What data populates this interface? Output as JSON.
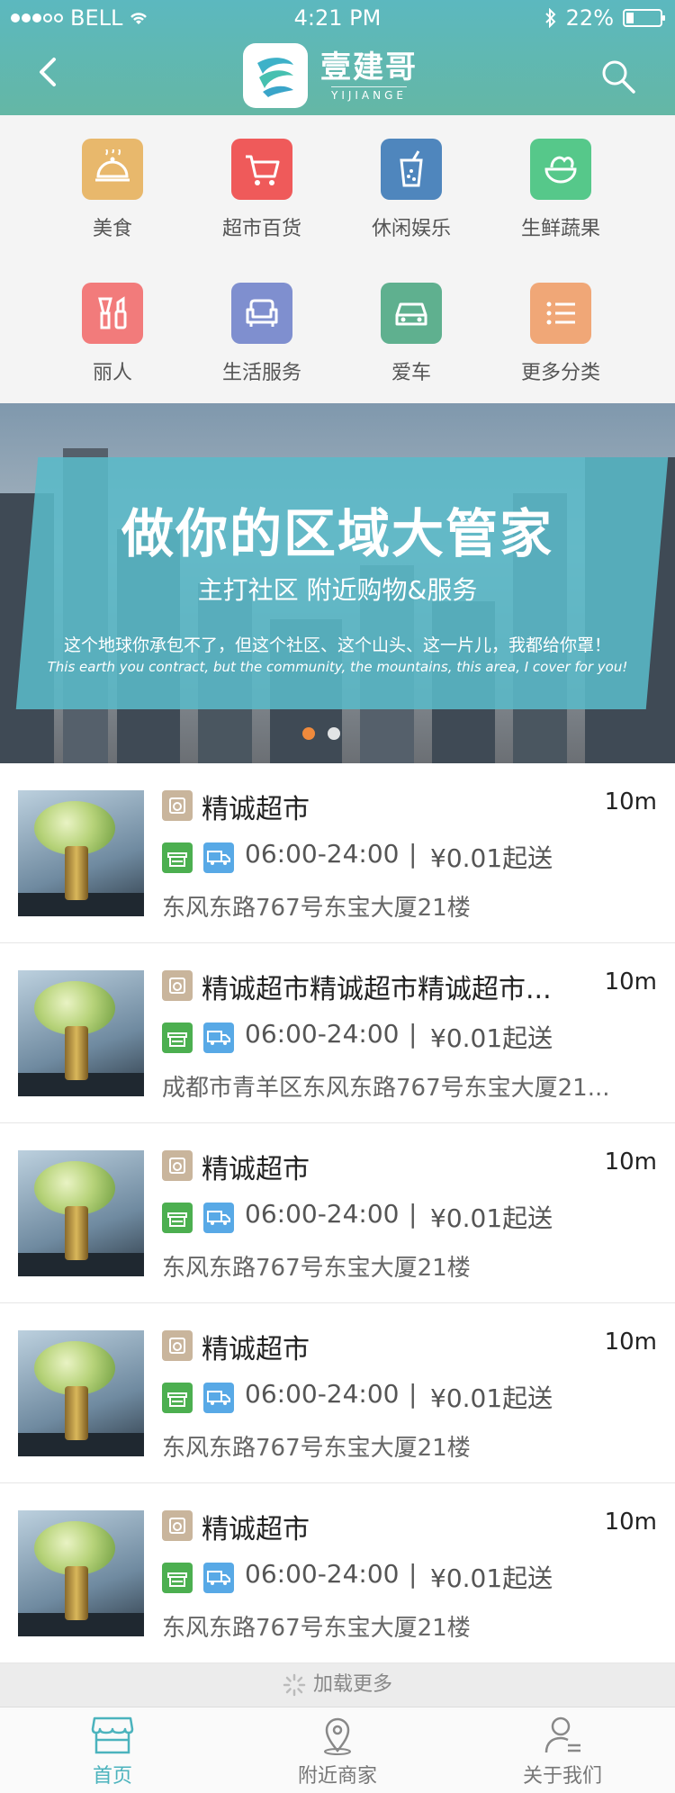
{
  "status_bar": {
    "carrier": "BELL",
    "time": "4:21 PM",
    "battery": "22%",
    "battery_level": 0.22
  },
  "header": {
    "back_icon": "chevron-left-icon",
    "logo_cn": "壹建哥",
    "logo_en": "YIJIANGE",
    "search_icon": "search-icon",
    "background_start": "#5cb8bf",
    "background_end": "#64b7a5"
  },
  "categories": [
    {
      "label": "美食",
      "icon": "food-dome-icon",
      "color": "#e8b86c"
    },
    {
      "label": "超市百货",
      "icon": "shopping-cart-icon",
      "color": "#ef5a5a"
    },
    {
      "label": "休闲娱乐",
      "icon": "drink-cup-icon",
      "color": "#4f86bd"
    },
    {
      "label": "生鲜蔬果",
      "icon": "vegetable-bowl-icon",
      "color": "#56c88a"
    },
    {
      "label": "丽人",
      "icon": "cosmetics-icon",
      "color": "#f27b7b"
    },
    {
      "label": "生活服务",
      "icon": "sofa-icon",
      "color": "#7f8fcf"
    },
    {
      "label": "爱车",
      "icon": "car-icon",
      "color": "#5fb08f"
    },
    {
      "label": "更多分类",
      "icon": "list-icon",
      "color": "#f0a777"
    }
  ],
  "banner": {
    "title": "做你的区域大管家",
    "subtitle": "主打社区  附近购物&服务",
    "line_cn": "这个地球你承包不了，但这个社区、这个山头、这一片儿，我都给你罩！",
    "line_en": "This earth you contract, but the community, the mountains, this area, I cover for you!",
    "active_page": 1,
    "page_count": 2
  },
  "shops": [
    {
      "name": "精诚超市",
      "distance": "10m",
      "hours": "06:00-24:00",
      "separator": "|",
      "min_order": "¥0.01起送",
      "address": "东风东路767号东宝大厦21楼"
    },
    {
      "name": "精诚超市精诚超市精诚超市...",
      "distance": "10m",
      "hours": "06:00-24:00",
      "separator": "|",
      "min_order": "¥0.01起送",
      "address": "成都市青羊区东风东路767号东宝大厦21..."
    },
    {
      "name": "精诚超市",
      "distance": "10m",
      "hours": "06:00-24:00",
      "separator": "|",
      "min_order": "¥0.01起送",
      "address": "东风东路767号东宝大厦21楼"
    },
    {
      "name": "精诚超市",
      "distance": "10m",
      "hours": "06:00-24:00",
      "separator": "|",
      "min_order": "¥0.01起送",
      "address": "东风东路767号东宝大厦21楼"
    },
    {
      "name": "精诚超市",
      "distance": "10m",
      "hours": "06:00-24:00",
      "separator": "|",
      "min_order": "¥0.01起送",
      "address": "东风东路767号东宝大厦21楼"
    }
  ],
  "load_more": {
    "label": "加载更多",
    "icon": "spinner-icon"
  },
  "tabbar": [
    {
      "label": "首页",
      "icon": "store-icon",
      "active": true
    },
    {
      "label": "附近商家",
      "icon": "location-pin-icon",
      "active": false
    },
    {
      "label": "关于我们",
      "icon": "user-profile-icon",
      "active": false
    }
  ],
  "colors": {
    "accent": "#4bb3bd",
    "pager_active": "#f08a3c",
    "tag_green": "#4caf50",
    "tag_blue": "#58a9e6",
    "shop_badge": "#c9b59c"
  }
}
